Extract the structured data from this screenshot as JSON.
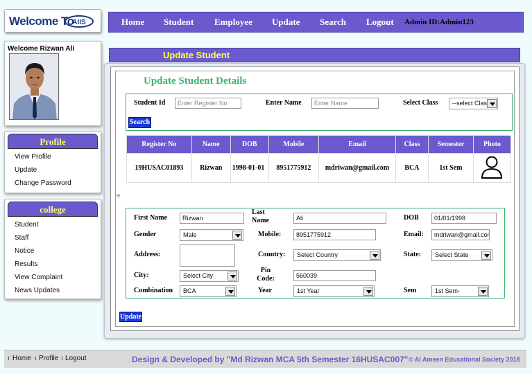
{
  "logo": {
    "text": "Welcome To",
    "mark_text": "AIIS"
  },
  "nav": {
    "items": [
      "Home",
      "Student",
      "Employee",
      "Update",
      "Search",
      "Logout"
    ],
    "admin_label": "Admin ID:Admin123"
  },
  "welcome": {
    "text": "Welcome Rizwan Ali"
  },
  "profile": {
    "title": "Profile",
    "links": [
      "View Profile",
      "Update",
      "Change Password"
    ]
  },
  "college": {
    "title": "college",
    "links": [
      "Student",
      "Staff",
      "Notice",
      "Results",
      "View Complaint",
      "News Updates"
    ]
  },
  "main": {
    "header": "Update Student",
    "title": "Update Student Details"
  },
  "search": {
    "student_id_label": "Student Id",
    "student_id_placeholder": "Enter Register No",
    "name_label": "Enter Name",
    "name_placeholder": "Enter Name",
    "class_label": "Select Class",
    "class_value": "--select Clas",
    "button": "Search"
  },
  "table": {
    "headers": [
      "Register No",
      "Name",
      "DOB",
      "Mobile",
      "Email",
      "Class",
      "Semester",
      "Photo"
    ],
    "rows": [
      {
        "register_no": "19HUSAC01893",
        "name": "Rizwan",
        "dob": "1998-01-01",
        "mobile": "8951775912",
        "email": "mdriwan@gmail.com",
        "class": "BCA",
        "semester": "1st Sem"
      }
    ]
  },
  "form": {
    "first_name_label": "First Name",
    "first_name": "Rizwan",
    "last_name_label": "Last Name",
    "last_name": "Ali",
    "dob_label": "DOB",
    "dob": "01/01/1998",
    "gender_label": "Gender",
    "gender": "Male",
    "mobile_label": "Mobile:",
    "mobile": "8951775912",
    "email_label": "Email:",
    "email": "mdriwan@gmail.com",
    "address_label": "Address:",
    "address": "",
    "country_label": "Country:",
    "country": "Select Country",
    "state_label": "State:",
    "state": "Select State",
    "city_label": "City:",
    "city": "Select City",
    "pin_label": "Pin Code:",
    "pin": "560039",
    "combination_label": "Combination",
    "combination": "BCA",
    "year_label": "Year",
    "year": "1st Year",
    "sem_label": "Sem",
    "sem": "1st Sem-",
    "update_button": "Update"
  },
  "footer": {
    "links": [
      "Home",
      "Profile",
      "Logout"
    ],
    "credit": "Design & Developed by \"Md Rizwan MCA 5th Semester 16HUSAC007\"",
    "society": "© Al Ameen Educational Society 2018"
  },
  "colors": {
    "brand_purple": "#6a5acd",
    "accent_yellow": "#ffff44",
    "accent_green": "#3cb371",
    "button_blue": "#1a3ad8"
  }
}
